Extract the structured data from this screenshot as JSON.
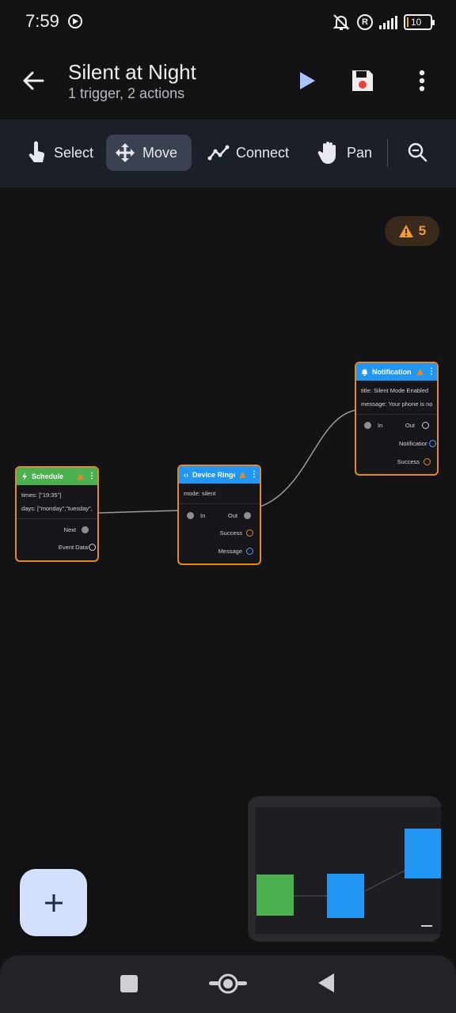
{
  "status_bar": {
    "time": "7:59",
    "battery": "10",
    "icons": [
      "play-circle-icon",
      "muted-icon",
      "r-icon",
      "signal-icon",
      "battery-icon"
    ]
  },
  "app_bar": {
    "title": "Silent at Night",
    "subtitle": "1 trigger, 2 actions"
  },
  "toolbar": {
    "tools": [
      {
        "label": "Select",
        "icon": "pointer-icon"
      },
      {
        "label": "Move",
        "icon": "move-icon",
        "active": true
      },
      {
        "label": "Connect",
        "icon": "connect-icon"
      },
      {
        "label": "Pan",
        "icon": "hand-icon"
      }
    ]
  },
  "warnings": {
    "count": "5",
    "color": "#f09a3e"
  },
  "nodes": {
    "schedule": {
      "title": "Schedule",
      "color": "#4caf50",
      "params": [
        "times: [\"19:35\"]",
        "days: [\"monday\",\"tuesday\",\"wednesday\",\"thursday\",\"friday\"]"
      ],
      "ports": {
        "next": "Next",
        "event_data": "Event Data"
      }
    },
    "device": {
      "title": "Device Ringer Mode",
      "color": "#2196f3",
      "params": [
        "mode: silent"
      ],
      "ports": {
        "in": "In",
        "out": "Out",
        "success": "Success",
        "message": "Message"
      }
    },
    "notification": {
      "title": "Notification",
      "color": "#2196f3",
      "params": [
        "title: Silent Mode Enabled",
        "message: Your phone is now in silent mode"
      ],
      "ports": {
        "in": "In",
        "out": "Out",
        "notification": "Notification ID",
        "success": "Success"
      }
    }
  },
  "colors": {
    "accent": "#d2e0fb",
    "warning": "#e08a2a",
    "trigger": "#4caf50",
    "action": "#2196f3"
  }
}
